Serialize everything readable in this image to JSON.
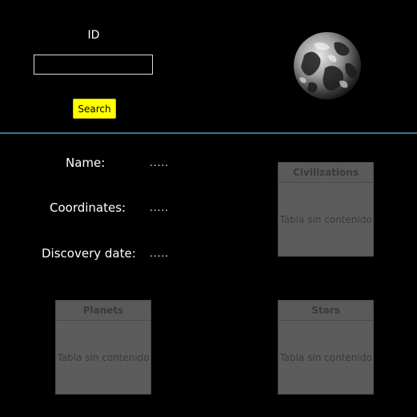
{
  "search": {
    "id_label": "ID",
    "input_value": "",
    "button_label": "Search",
    "button_color": "#ffff00"
  },
  "divider_color": "#2a7b93",
  "details": {
    "name_label": "Name:",
    "name_value": ".....",
    "coordinates_label": "Coordinates:",
    "coordinates_value": ".....",
    "discovery_label": "Discovery date:",
    "discovery_value": "....."
  },
  "tables": {
    "civilizations": {
      "header": "Civilizations",
      "empty_text": "Tabla sin contenido"
    },
    "planets": {
      "header": "Planets",
      "empty_text": "Tabla sin contenido"
    },
    "stars": {
      "header": "Stars",
      "empty_text": "Tabla sin contenido"
    }
  },
  "icons": {
    "globe": "earth-globe-icon"
  }
}
